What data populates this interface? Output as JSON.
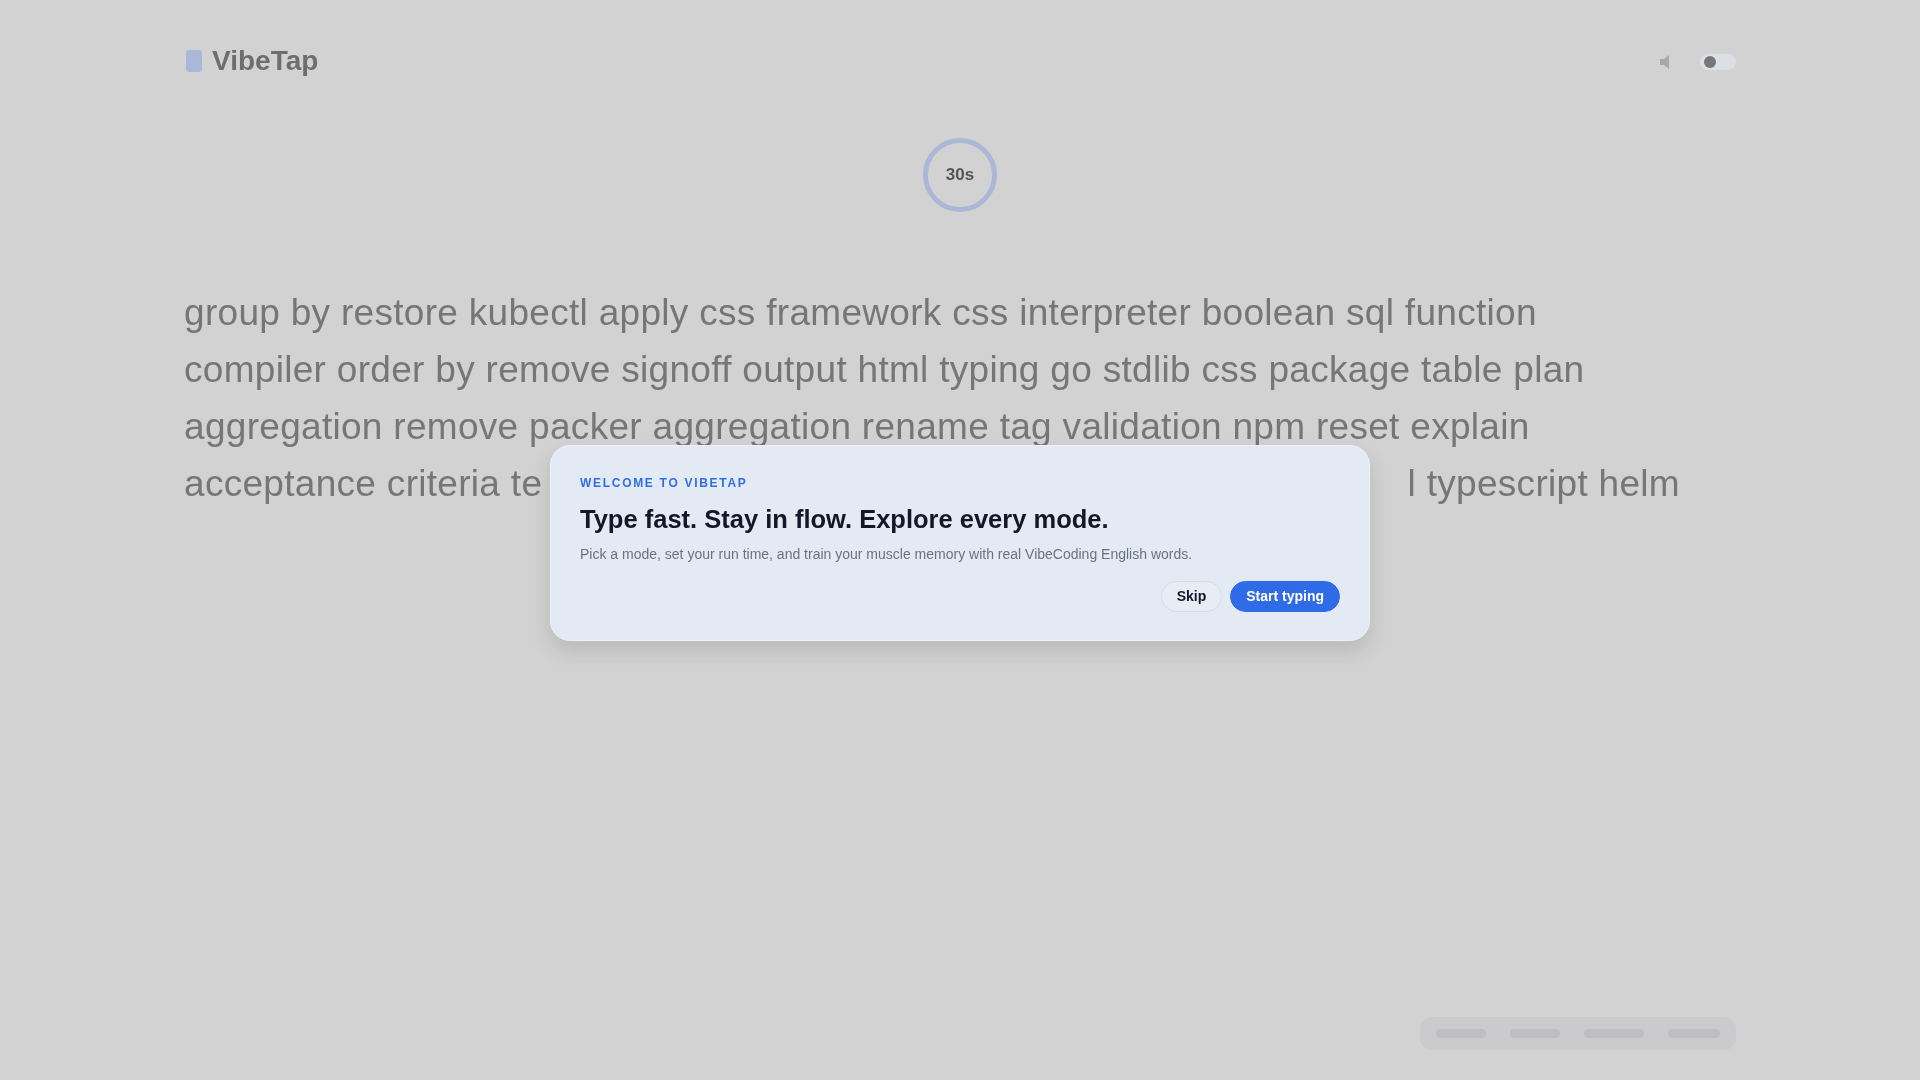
{
  "header": {
    "logo": "VibeTap"
  },
  "timer": {
    "label": "30s"
  },
  "words": {
    "lines": [
      [
        "group by restore kubectl apply css framework css interpreter boolean sql function"
      ],
      [
        "compiler order by remove signoff output html typing go stdlib css package table plan"
      ],
      [
        "aggregation remove packer aggregation rename tag validation npm reset explain"
      ],
      [
        "acceptance criteria te",
        "l typescript helm"
      ]
    ]
  },
  "dialog": {
    "eyebrow": "WELCOME TO VIBETAP",
    "title": "Type fast. Stay in flow. Explore every mode.",
    "text": "Pick a mode, set your run time, and train your muscle memory with real VibeCoding English words.",
    "buttons": [
      {
        "label": "Skip",
        "kind": "secondary"
      },
      {
        "label": "Start typing",
        "kind": "primary"
      }
    ]
  }
}
